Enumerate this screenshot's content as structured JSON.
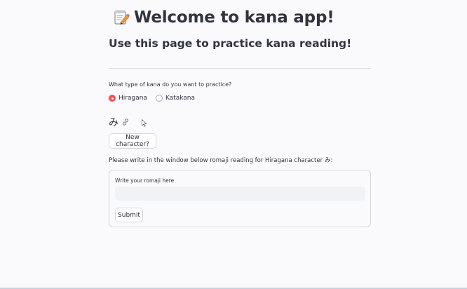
{
  "header": {
    "title": "Welcome to kana app!",
    "title_icon": "memo-pencil-icon",
    "subtitle": "Use this page to practice kana reading!"
  },
  "practice": {
    "question": "What type of kana do you want to practice?",
    "options": [
      {
        "label": "Hiragana",
        "selected": true
      },
      {
        "label": "Katakana",
        "selected": false
      }
    ],
    "current_character": "み",
    "link_icon": "link-icon",
    "new_character_button": "New character?",
    "instruction": "Please write in the window below romaji reading for Hiragana character み:"
  },
  "form": {
    "input_label": "Write your romaji here",
    "input_value": "",
    "input_placeholder": "",
    "submit_button": "Submit"
  },
  "colors": {
    "accent": "#ff4b4b",
    "text": "#31333f",
    "input_bg": "#f0f2f6",
    "page_bg": "#fafafc"
  }
}
